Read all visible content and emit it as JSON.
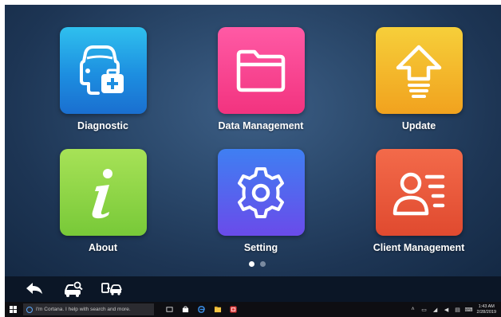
{
  "apps": [
    {
      "id": "diagnostic",
      "label": "Diagnostic",
      "icon": "car-medical-kit-icon",
      "color": "#1d8ee0"
    },
    {
      "id": "data-management",
      "label": "Data Management",
      "icon": "folder-icon",
      "color": "#f2337f"
    },
    {
      "id": "update",
      "label": "Update",
      "icon": "up-arrow-icon",
      "color": "#f1a21e"
    },
    {
      "id": "about",
      "label": "About",
      "icon": "info-i-icon",
      "color": "#78c938"
    },
    {
      "id": "setting",
      "label": "Setting",
      "icon": "gear-icon",
      "color": "#5265ee"
    },
    {
      "id": "client-management",
      "label": "Client Management",
      "icon": "person-list-icon",
      "color": "#e04a2f"
    }
  ],
  "pager": {
    "pages": 2,
    "current": 1
  },
  "navbar": {
    "icons": [
      "back-arrow-icon",
      "car-search-icon",
      "car-transfer-icon"
    ]
  },
  "taskbar": {
    "search_placeholder": "I'm Cortana. I help with search and more.",
    "clock_time": "1:43 AM",
    "clock_date": "2/28/2019"
  }
}
